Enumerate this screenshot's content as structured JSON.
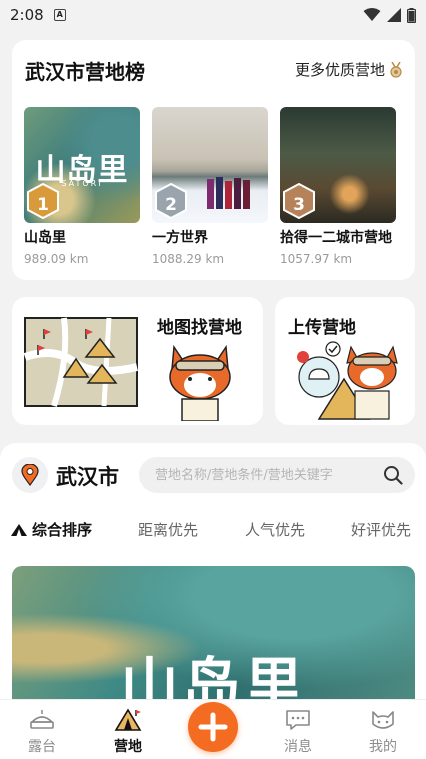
{
  "status": {
    "time": "2:08",
    "sim_badge": "A"
  },
  "ranking": {
    "title": "武汉市营地榜",
    "more_label": "更多优质营地",
    "items": [
      {
        "rank": "1",
        "name": "山岛里",
        "distance": "989.09 km",
        "logo": "山岛里",
        "logo_sub": "SATORI"
      },
      {
        "rank": "2",
        "name": "一方世界",
        "distance": "1088.29 km"
      },
      {
        "rank": "3",
        "name": "拾得一二城市营地",
        "distance": "1057.97 km"
      }
    ]
  },
  "features": {
    "map_title": "地图找营地",
    "upload_title": "上传营地"
  },
  "location": {
    "city": "武汉市"
  },
  "search": {
    "placeholder": "营地名称/营地条件/营地关键字"
  },
  "sort_tabs": [
    "综合排序",
    "距离优先",
    "人气优先",
    "好评优先"
  ],
  "banner": {
    "logo": "山岛里"
  },
  "tabbar": {
    "items": [
      {
        "label": "露台",
        "icon": "tent-platform-icon"
      },
      {
        "label": "营地",
        "icon": "camp-tent-icon",
        "active": true
      },
      {
        "label": "",
        "icon": "plus-icon"
      },
      {
        "label": "消息",
        "icon": "chat-bubble-icon"
      },
      {
        "label": "我的",
        "icon": "cat-face-icon"
      }
    ]
  },
  "colors": {
    "accent": "#f36c21",
    "background": "#f2f2f2",
    "muted_text": "#9a9a9a"
  }
}
